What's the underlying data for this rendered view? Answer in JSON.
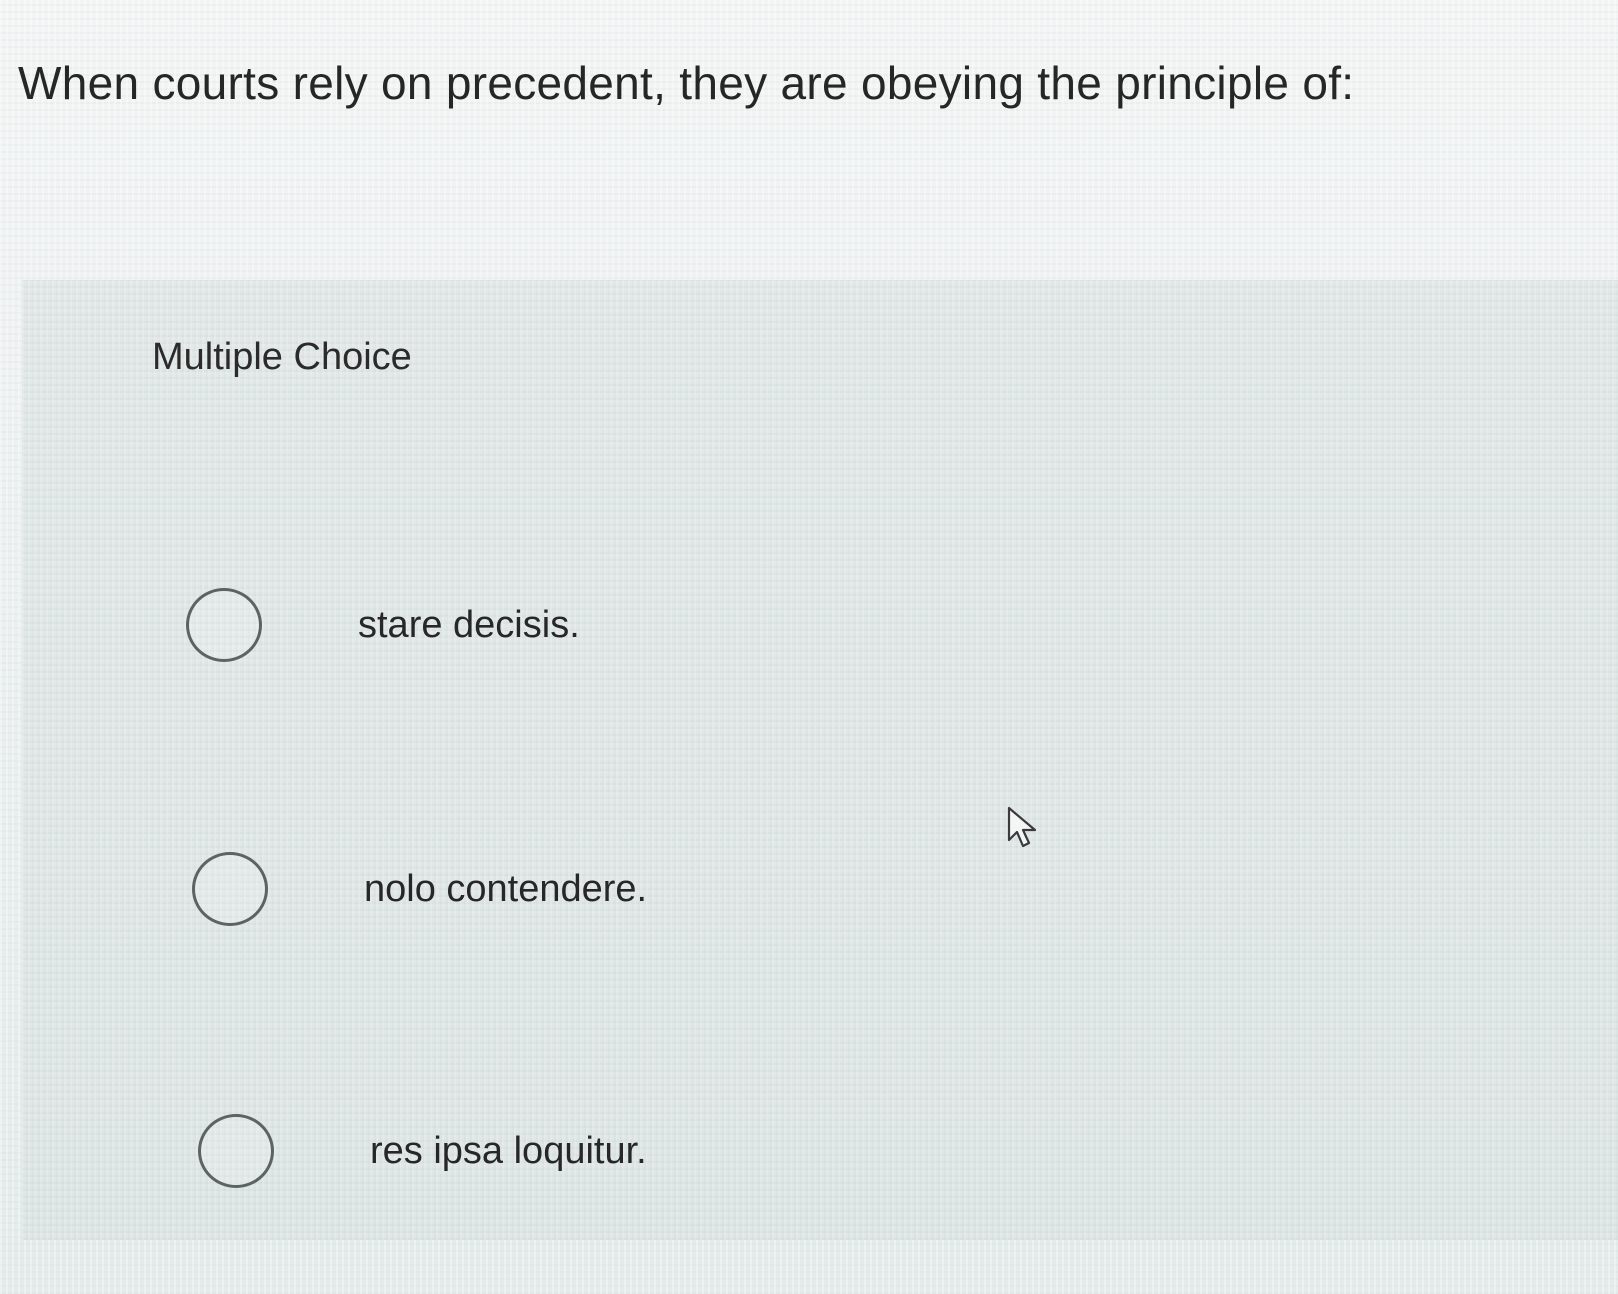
{
  "question": {
    "text": "When courts rely on precedent, they are obeying the principle of:"
  },
  "answer_panel": {
    "type_label": "Multiple Choice",
    "options": [
      {
        "label": "stare decisis.",
        "selected": false
      },
      {
        "label": "nolo contendere.",
        "selected": false
      },
      {
        "label": "res ipsa loquitur.",
        "selected": false
      }
    ]
  },
  "icons": {
    "cursor": "mouse-pointer-icon"
  }
}
